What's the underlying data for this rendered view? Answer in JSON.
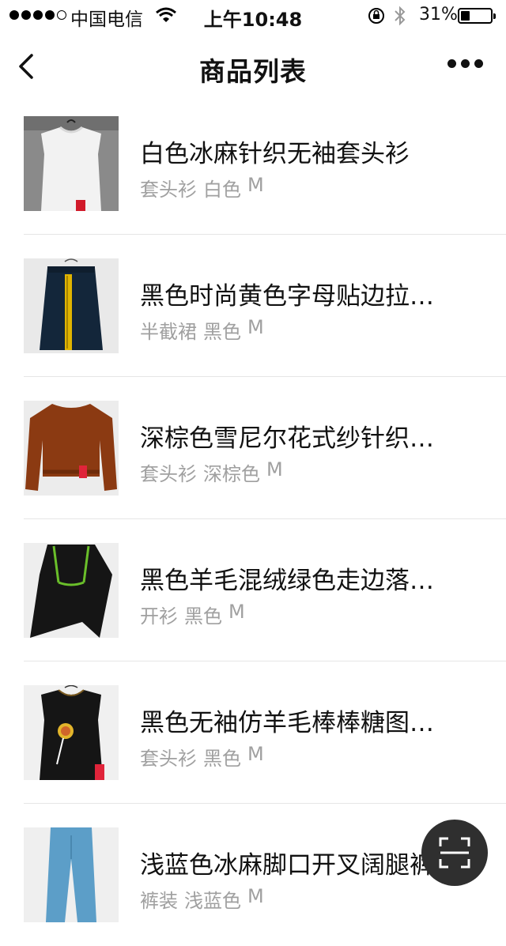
{
  "status_bar": {
    "carrier": "中国电信",
    "time": "上午10:48",
    "battery_percent": "31%",
    "battery_level": 0.31,
    "signal_bars_filled": 4,
    "signal_bars_total": 5
  },
  "nav": {
    "title": "商品列表",
    "back_icon": "chevron-left-icon",
    "more_icon": "more-dots-icon"
  },
  "products": [
    {
      "name": "白色冰麻针织无袖套头衫",
      "category": "套头衫",
      "color": "白色",
      "size": "M"
    },
    {
      "name": "黑色时尚黄色字母贴边拉…",
      "category": "半截裙",
      "color": "黑色",
      "size": "M"
    },
    {
      "name": "深棕色雪尼尔花式纱针织…",
      "category": "套头衫",
      "color": "深棕色",
      "size": "M"
    },
    {
      "name": "黑色羊毛混绒绿色走边落…",
      "category": "开衫",
      "color": "黑色",
      "size": "M"
    },
    {
      "name": "黑色无袖仿羊毛棒棒糖图…",
      "category": "套头衫",
      "color": "黑色",
      "size": "M"
    },
    {
      "name": "浅蓝色冰麻脚口开叉阔腿裤",
      "category": "裤装",
      "color": "浅蓝色",
      "size": "M"
    }
  ],
  "fab": {
    "icon": "scan-icon"
  }
}
